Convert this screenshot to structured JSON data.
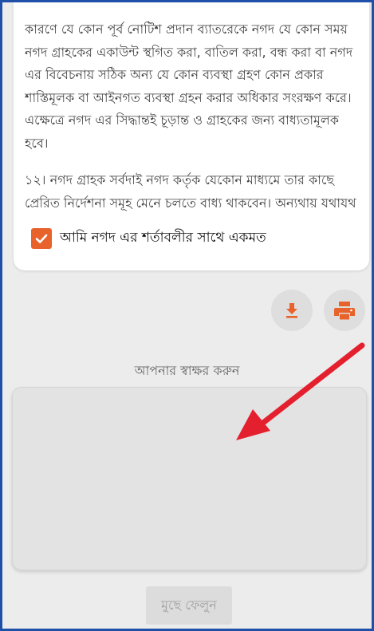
{
  "terms": {
    "paragraph_1": "কারণে যে কোন পূর্ব নোটিশ প্রদান ব্যাতরেকে নগদ যে কোন সময় নগদ গ্রাহকের একাউন্ট স্থগিত করা, বাতিল করা, বন্ধ করা বা নগদ এর বিবেচনায় সঠিক অন্য যে কোন ব্যবস্থা গ্রহণ কোন প্রকার শাস্তিমূলক বা আইনগত ব্যবস্থা গ্রহন করার অধিকার সংরক্ষণ করে। এক্ষেত্রে নগদ এর সিদ্ধান্তই চূড়ান্ত ও গ্রাহকের জন্য বাধ্যতামূলক হবে।",
    "paragraph_2": "১২। নগদ গ্রাহক সর্বদাই নগদ কর্তৃক যেকোন মাধ্যমে তার কাছে প্রেরিত নির্দেশনা সমূহ মেনে চলতে বাধ্য থাকবেন। অন্যথায় যথাযথ তদন্ত সাপেক্ষে নগদ উক্ত নগদ গ্রাহকের"
  },
  "agree": {
    "label": "আমি নগদ এর শর্তাবলীর সাথে একমত",
    "checked": true
  },
  "actions": {
    "download_icon": "download-icon",
    "print_icon": "print-icon"
  },
  "signature": {
    "label": "আপনার স্বাক্ষর করুন"
  },
  "clear_button": {
    "label": "মুছে ফেলুন"
  },
  "colors": {
    "accent": "#e8622c",
    "annotation_arrow": "#e5202e"
  }
}
